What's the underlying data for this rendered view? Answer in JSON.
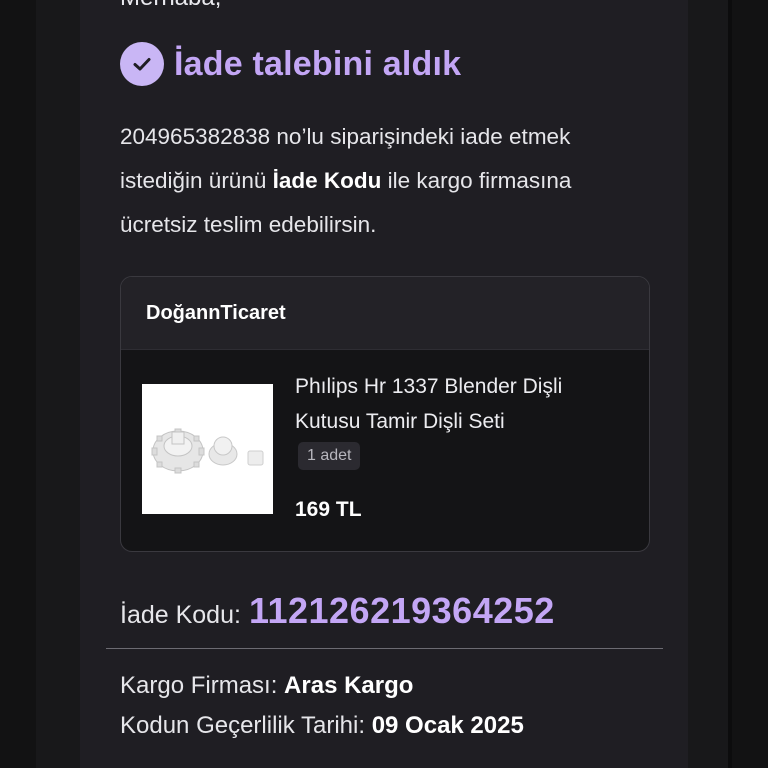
{
  "email": {
    "greeting": "Merhaba,",
    "headline": "İade talebini aldık",
    "intro": {
      "part1": "204965382838 no’lu siparişindeki iade etmek istediğin ürünü ",
      "bold": "İade Kodu",
      "part2": " ile kargo firmasına ücretsiz teslim edebilirsin."
    }
  },
  "order_card": {
    "seller": "DoğannTicaret",
    "product_name": "Phılips Hr 1337 Blender Dişli Kutusu Tamir Dişli Seti",
    "quantity": "1 adet",
    "price": "169 TL"
  },
  "return_info": {
    "code_label": "İade Kodu:",
    "code_value": "112126219364252",
    "carrier_label": "Kargo Firması:",
    "carrier_value": "Aras Kargo",
    "validity_label": "Kodun Geçerlilik Tarihi:",
    "validity_value": "09 Ocak 2025"
  },
  "icons": {
    "headline_icon": "check-circle-icon"
  },
  "colors": {
    "accent": "#c3a6f5",
    "background": "#1f1e23"
  }
}
